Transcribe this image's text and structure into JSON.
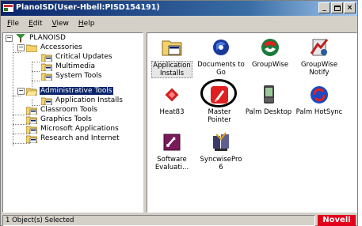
{
  "window": {
    "title": "PlanoISD(User-Hbell:PISD154191)",
    "controls": {
      "minimize": "_",
      "close": "×"
    }
  },
  "menu": [
    {
      "label": "File",
      "hot": "F",
      "rest": "ile"
    },
    {
      "label": "Edit",
      "hot": "E",
      "rest": "dit"
    },
    {
      "label": "View",
      "hot": "V",
      "rest": "iew"
    },
    {
      "label": "Help",
      "hot": "H",
      "rest": "elp"
    }
  ],
  "tree": {
    "root": "PLANOISD",
    "items": [
      {
        "label": "Accessories"
      },
      {
        "label": "Critical Updates"
      },
      {
        "label": "Multimedia"
      },
      {
        "label": "System Tools"
      },
      {
        "label": "Administrative Tools",
        "selected": true
      },
      {
        "label": "Application Installs"
      },
      {
        "label": "Classroom Tools"
      },
      {
        "label": "Graphics Tools"
      },
      {
        "label": "Microsoft Applications"
      },
      {
        "label": "Research and Internet"
      }
    ]
  },
  "icons": [
    {
      "line1": "Application",
      "line2": "Installs",
      "icon": "folder-icon",
      "selected": true
    },
    {
      "line1": "Documents to",
      "line2": "Go",
      "icon": "documents-to-go-icon"
    },
    {
      "line1": "GroupWise",
      "line2": "",
      "icon": "groupwise-icon"
    },
    {
      "line1": "GroupWise",
      "line2": "Notify",
      "icon": "groupwise-notify-icon"
    },
    {
      "line1": "Heat83",
      "line2": "",
      "icon": "heat83-icon"
    },
    {
      "line1": "Master Pointer",
      "line2": "",
      "icon": "master-pointer-icon"
    },
    {
      "line1": "Palm Desktop",
      "line2": "",
      "icon": "palm-desktop-icon"
    },
    {
      "line1": "Palm HotSync",
      "line2": "",
      "icon": "palm-hotsync-icon"
    },
    {
      "line1": "Software",
      "line2": "Evaluati...",
      "icon": "software-evaluation-icon"
    },
    {
      "line1": "SyncwisePro 6",
      "line2": "",
      "icon": "syncwisepro-icon"
    }
  ],
  "status": {
    "text": "1 Object(s) Selected",
    "brand": "Novell",
    "brand_color": "#e2001a"
  },
  "colors": {
    "titlebar": "#0a246a",
    "selection": "#0a246a"
  }
}
